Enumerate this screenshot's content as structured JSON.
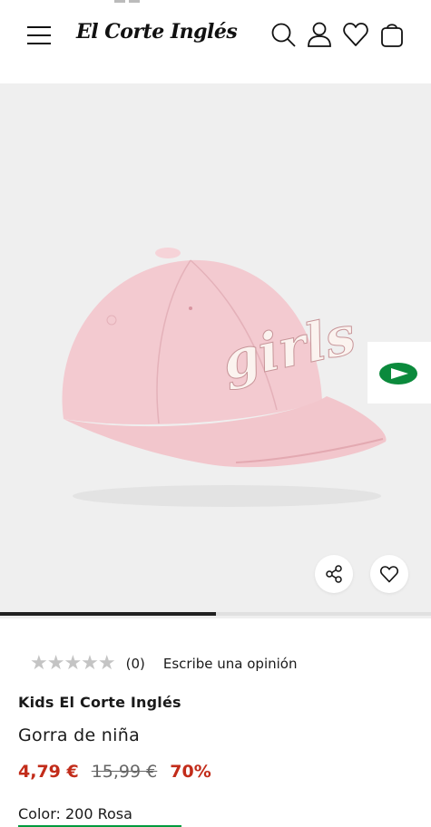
{
  "header": {
    "logo_text": "El Corte Inglés",
    "icons": [
      "menu-icon",
      "search-icon",
      "user-icon",
      "heart-icon",
      "bag-icon"
    ]
  },
  "gallery": {
    "cap_print": "girls",
    "progress": 0.5,
    "icons": [
      "arrow-right-icon",
      "share-icon",
      "heart-icon"
    ]
  },
  "product": {
    "rating_count": "(0)",
    "review_link": "Escribe una opinión",
    "stars_filled": 0,
    "stars_total": 5,
    "brand": "Kids El Corte Inglés",
    "title": "Gorra de niña",
    "price_now": "4,79 €",
    "price_old": "15,99 €",
    "discount": "70%",
    "color_label": "Color: 200 Rosa"
  },
  "colors": {
    "brand_green": "#009a3e",
    "price_red": "#c22c1a",
    "gallery_bg": "#efefef",
    "cap_pink": "#f2c9cf"
  }
}
